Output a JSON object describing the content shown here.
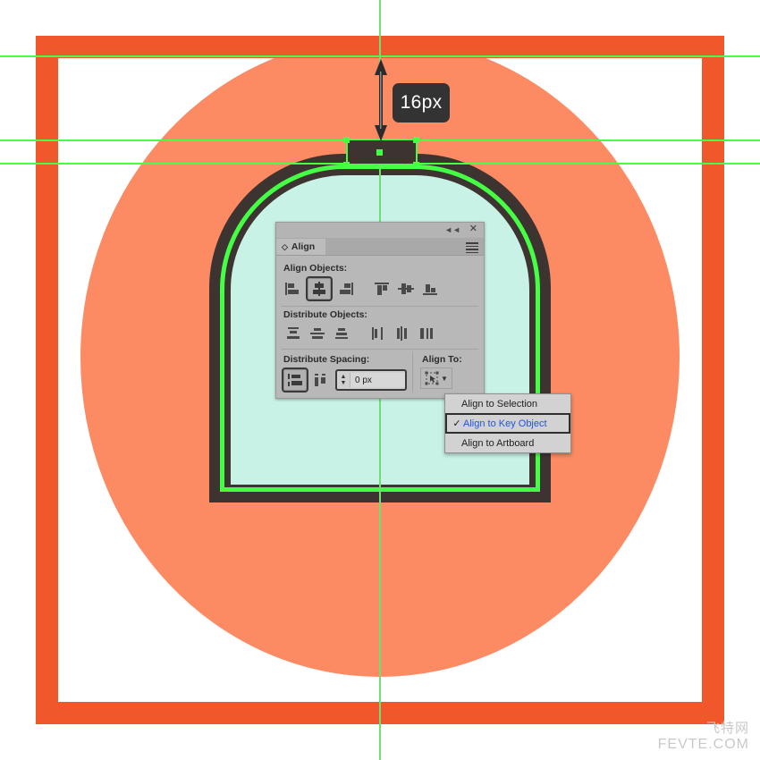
{
  "canvas": {
    "measure_label": "16px",
    "colors": {
      "frame_orange": "#F0572A",
      "circle_salmon": "#FC8A62",
      "door_dark": "#3D3431",
      "door_mint": "#C8F2E6",
      "guide_green": "#44FF44",
      "selection_green": "#44FF44"
    }
  },
  "panel": {
    "title": "Align",
    "tab_icon": "diamond-icon",
    "collapse_icon": "double-chevron-left-icon",
    "close_icon": "close-icon",
    "menu_icon": "hamburger-menu-icon",
    "sections": {
      "align_objects": {
        "label": "Align Objects:",
        "buttons": [
          {
            "name": "horizontal-align-left",
            "active": false
          },
          {
            "name": "horizontal-align-center",
            "active": true
          },
          {
            "name": "horizontal-align-right",
            "active": false
          },
          {
            "name": "vertical-align-top",
            "active": false
          },
          {
            "name": "vertical-align-center",
            "active": false
          },
          {
            "name": "vertical-align-bottom",
            "active": false
          }
        ]
      },
      "distribute_objects": {
        "label": "Distribute Objects:",
        "buttons": [
          {
            "name": "vertical-distribute-top",
            "active": false
          },
          {
            "name": "vertical-distribute-center",
            "active": false
          },
          {
            "name": "vertical-distribute-bottom",
            "active": false
          },
          {
            "name": "horizontal-distribute-left",
            "active": false
          },
          {
            "name": "horizontal-distribute-center",
            "active": false
          },
          {
            "name": "horizontal-distribute-right",
            "active": false
          }
        ]
      },
      "distribute_spacing": {
        "label": "Distribute Spacing:",
        "buttons": [
          {
            "name": "vertical-distribute-spacing",
            "active": true
          },
          {
            "name": "horizontal-distribute-spacing",
            "active": false
          }
        ],
        "spacing_value": "0 px"
      },
      "align_to": {
        "label": "Align To:",
        "selected_icon": "align-to-key-object-icon",
        "chevron": "chevron-down-icon"
      }
    }
  },
  "dropdown": {
    "items": [
      {
        "label": "Align to Selection",
        "checked": false,
        "selected": false
      },
      {
        "label": "Align to Key Object",
        "checked": true,
        "selected": true
      },
      {
        "label": "Align to Artboard",
        "checked": false,
        "selected": false
      }
    ],
    "check_glyph": "✓"
  },
  "watermark": {
    "cn": "飞特网",
    "en": "FEVTE.COM"
  }
}
